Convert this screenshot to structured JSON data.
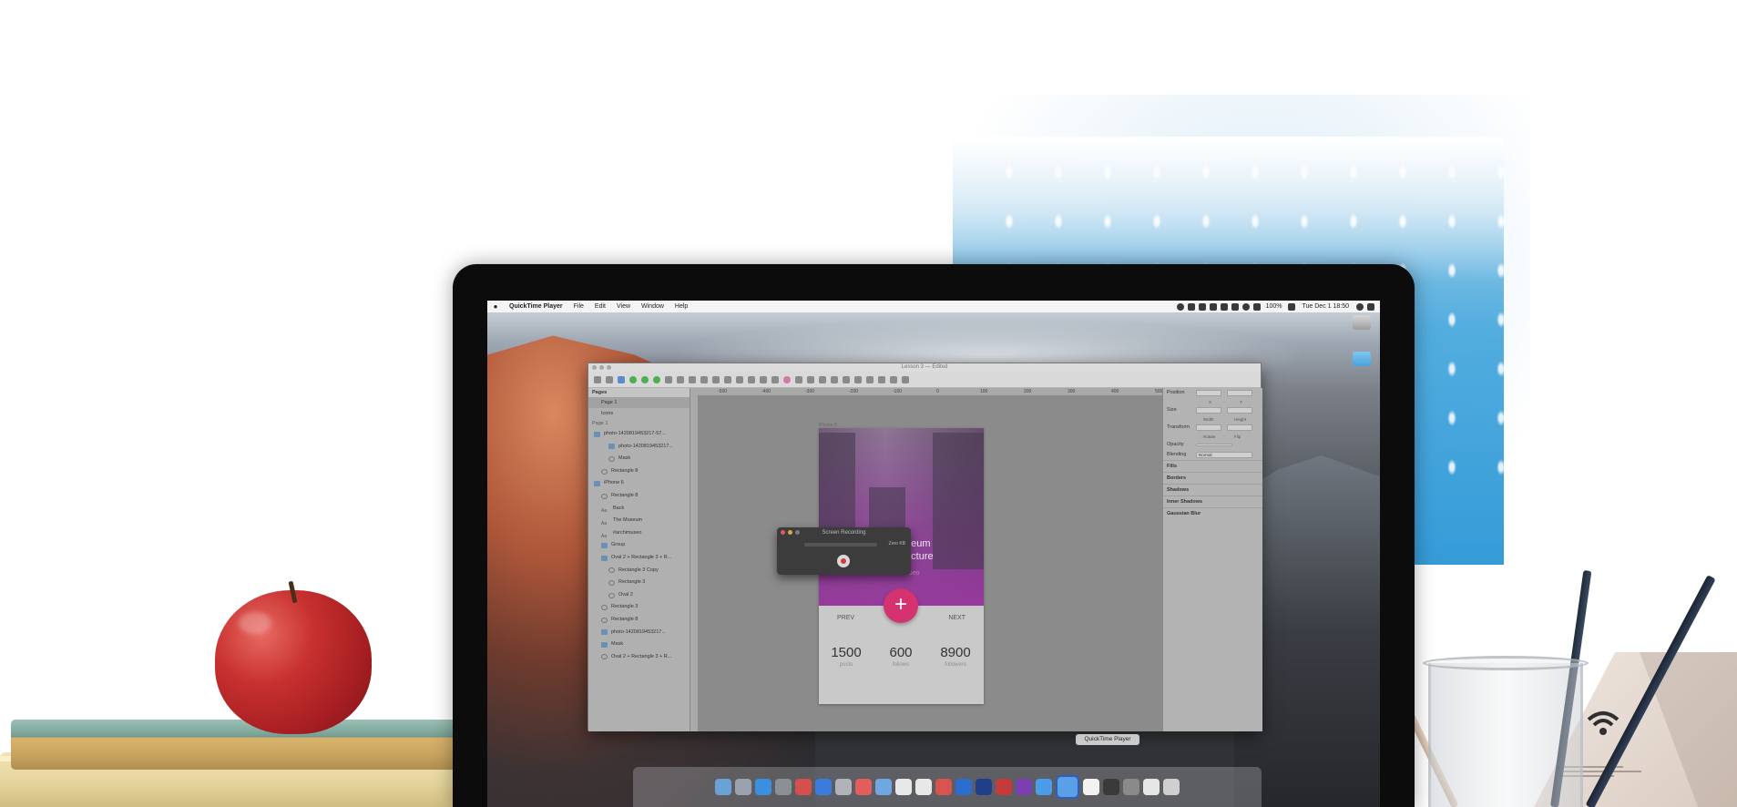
{
  "menubar": {
    "app_name": "QuickTime Player",
    "menus": [
      "File",
      "Edit",
      "View",
      "Window",
      "Help"
    ],
    "battery": "100%",
    "clock": "Tue Dec 1  18:50"
  },
  "sketch": {
    "title": "Lesson 3",
    "title_suffix": "— Edited",
    "pages_header": "Pages",
    "pages": [
      "Page 1",
      "Icons"
    ],
    "page_group_label": "Page 1",
    "layers": [
      {
        "name": "photo-1420819453217-57...",
        "indent": 0,
        "kind": "folder"
      },
      {
        "name": "photo-1420819453217...",
        "indent": 2,
        "kind": "image"
      },
      {
        "name": "Mask",
        "indent": 2,
        "kind": "shape"
      },
      {
        "name": "Rectangle 8",
        "indent": 1,
        "kind": "shape"
      },
      {
        "name": "iPhone 6",
        "indent": 0,
        "kind": "artboard"
      },
      {
        "name": "Rectangle 8",
        "indent": 1,
        "kind": "shape"
      },
      {
        "name": "Back",
        "indent": 1,
        "kind": "text"
      },
      {
        "name": "The Museum",
        "indent": 1,
        "kind": "text"
      },
      {
        "name": "#archimuseo",
        "indent": 1,
        "kind": "text"
      },
      {
        "name": "Group",
        "indent": 1,
        "kind": "folder"
      },
      {
        "name": "Oval 2 + Rectangle 3 + R...",
        "indent": 1,
        "kind": "folder"
      },
      {
        "name": "Rectangle 3 Copy",
        "indent": 2,
        "kind": "shape"
      },
      {
        "name": "Rectangle 3",
        "indent": 2,
        "kind": "shape"
      },
      {
        "name": "Oval 2",
        "indent": 2,
        "kind": "shape"
      },
      {
        "name": "Rectangle 3",
        "indent": 1,
        "kind": "shape"
      },
      {
        "name": "Rectangle 8",
        "indent": 1,
        "kind": "shape"
      },
      {
        "name": "photo-1420819453217...",
        "indent": 1,
        "kind": "image"
      },
      {
        "name": "Mask",
        "indent": 1,
        "kind": "folder"
      },
      {
        "name": "Oval 2 + Rectangle 3 + R...",
        "indent": 1,
        "kind": "shape"
      }
    ],
    "ruler_labels": [
      "-500",
      "-400",
      "-300",
      "-200",
      "-100",
      "0",
      "100",
      "200",
      "300",
      "400",
      "500"
    ],
    "artboard_label": "iPhone 6",
    "inspector": {
      "position": "Position",
      "x_label": "X",
      "y_label": "Y",
      "size": "Size",
      "width_label": "Width",
      "height_label": "Height",
      "transform": "Transform",
      "rotate_label": "Rotate",
      "flip_label": "Flip",
      "opacity": "Opacity",
      "blending": "Blending",
      "blending_value": "Normal",
      "sections": [
        "Fills",
        "Borders",
        "Shadows",
        "Inner Shadows",
        "Gaussian Blur"
      ]
    }
  },
  "mockup": {
    "title_line1": "The Museum",
    "title_line2": "of Architecture",
    "hashtag": "#archimuseo",
    "plus": "+",
    "prev": "PREV",
    "next": "NEXT",
    "stats": [
      {
        "value": "1500",
        "label": "posts"
      },
      {
        "value": "600",
        "label": "follows"
      },
      {
        "value": "8900",
        "label": "followers"
      }
    ]
  },
  "recording": {
    "title": "Screen Recording",
    "size": "Zero KB"
  },
  "dock": {
    "tooltip": "QuickTime Player",
    "icon_colors": [
      "#6aa2d8",
      "#9aa3ad",
      "#3b8fe0",
      "#8b8f96",
      "#d64f4f",
      "#3a7be0",
      "#b0b4b9",
      "#e35d5d",
      "#6fa7e0",
      "#e8e8e8",
      "#e8e8e8",
      "#d9534f",
      "#2c6ecf",
      "#1f3f8a",
      "#c43b3b",
      "#7a3fb0",
      "#4a9be8",
      "#5aa0e6",
      "#f2f2f2",
      "#3a3a3a",
      "#8a8a8a",
      "#e6e6e6",
      "#cfcfcf"
    ]
  }
}
